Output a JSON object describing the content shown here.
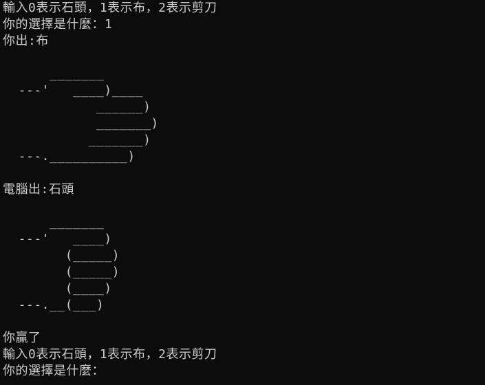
{
  "terminal": {
    "lines": [
      "輸入0表示石頭，1表示布，2表示剪刀",
      "你的選擇是什麼：1",
      "你出:布",
      "",
      "      _______",
      "  ---'   ____)____",
      "            ______)",
      "            _______)",
      "           _______)",
      "  ---.__________)",
      "",
      "電腦出:石頭",
      "",
      "      _______",
      "  ---'   ____)",
      "        (_____)",
      "        (_____)",
      "        (____)",
      "  ---.__(___)",
      "",
      "你贏了",
      "輸入0表示石頭，1表示布，2表示剪刀",
      "你的選擇是什麼："
    ]
  }
}
